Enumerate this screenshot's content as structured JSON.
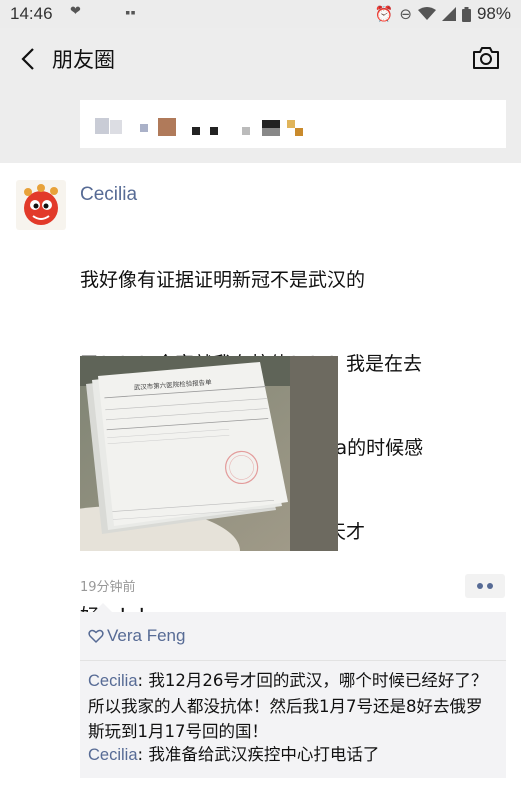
{
  "status_bar": {
    "time": "14:46",
    "battery": "98%",
    "icons": [
      "heart-icon",
      "alarm-icon",
      "do-not-disturb-icon",
      "wifi-icon",
      "signal-icon",
      "battery-icon"
    ]
  },
  "nav": {
    "title": "朋友圈",
    "icons": [
      "back-arrow-icon",
      "camera-icon"
    ]
  },
  "post": {
    "author": "Cecilia",
    "text_lines": [
      "我好像有证据证明新冠不是武汉的",
      "了！！！全家就我有抗体！！！我是在去",
      "年12月6号还是7号在伦敦考cfa的时候感",
      "染的！重感冒加发烧一共十几天才",
      "好！！！"
    ],
    "image_caption": "武汉市第六医院检验报告单",
    "time": "19分钟前"
  },
  "likes": {
    "names": "Vera Feng"
  },
  "comments": [
    {
      "author": "Cecilia",
      "separator": ": ",
      "text": "我12月26号才回的武汉，哪个时候已经好了？所以我家的人都没抗体！然后我1月7号还是8好去俄罗斯玩到1月17号回的国！"
    },
    {
      "author": "Cecilia",
      "separator": ": ",
      "text": "我准备给武汉疾控中心打电话了"
    }
  ],
  "colors": {
    "link_blue": "#576b95",
    "background": "#ededed",
    "card": "#ffffff",
    "comment_bg": "#f3f3f5"
  }
}
